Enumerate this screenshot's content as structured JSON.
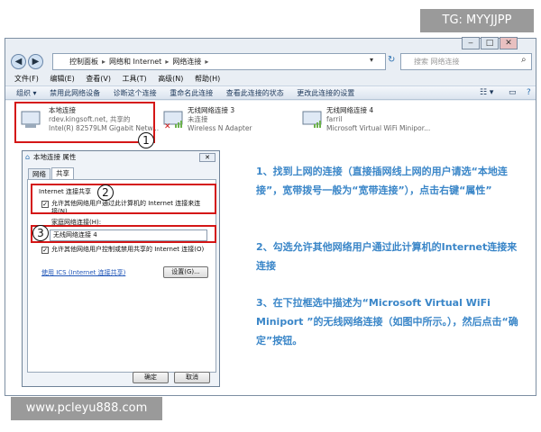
{
  "watermark_top": "TG: MYYJJPP",
  "watermark_bottom": "www.pcleyu888.com",
  "address": {
    "path": [
      "控制面板",
      "网络和 Internet",
      "网络连接"
    ],
    "search_placeholder": "搜索 网络连接"
  },
  "menu": [
    "文件(F)",
    "编辑(E)",
    "查看(V)",
    "工具(T)",
    "高级(N)",
    "帮助(H)"
  ],
  "toolbar": [
    "组织 ▾",
    "禁用此网络设备",
    "诊断这个连接",
    "重命名此连接",
    "查看此连接的状态",
    "更改此连接的设置"
  ],
  "connections": [
    {
      "name": "本地连接",
      "line2": "rdev.kingsoft.net, 共享的",
      "line3": "Intel(R) 82579LM Gigabit Netw..."
    },
    {
      "name": "无线网络连接 3",
      "line2": "未连接",
      "line3": "Wireless N Adapter"
    },
    {
      "name": "无线网络连接 4",
      "line2": "farril",
      "line3": "Microsoft Virtual WiFi Minipor..."
    }
  ],
  "dialog": {
    "title": "本地连接 属性",
    "close": "✕",
    "tabs": [
      "网络",
      "共享"
    ],
    "section_label": "Internet 连接共享",
    "allow_label": "允许其他网络用户通过此计算机的 Internet 连接来连接(N)",
    "home_label": "家庭网络连接(H):",
    "home_value": "无线网络连接 4",
    "control_label": "允许其他网络用户控制或禁用共享的 Internet 连接(O)",
    "ics_link": "使用 ICS (Internet 连接共享)",
    "settings_btn": "设置(G)...",
    "ok_btn": "确定",
    "cancel_btn": "取消"
  },
  "badges": [
    "1",
    "2",
    "3"
  ],
  "steps": [
    "1、找到上网的连接（直接插网线上网的用户请选“本地连接”，宽带拨号一般为“宽带连接”），点击右键“属性”",
    "2、勾选允许其他网络用户通过此计算机的Internet连接来连接",
    "3、在下拉框选中描述为“Microsoft Virtual WiFi Miniport ”的无线网络连接（如图中所示。），然后点击“确定”按钮。"
  ],
  "colors": {
    "accent_red": "#d41616",
    "step_blue": "#3a86c8"
  }
}
